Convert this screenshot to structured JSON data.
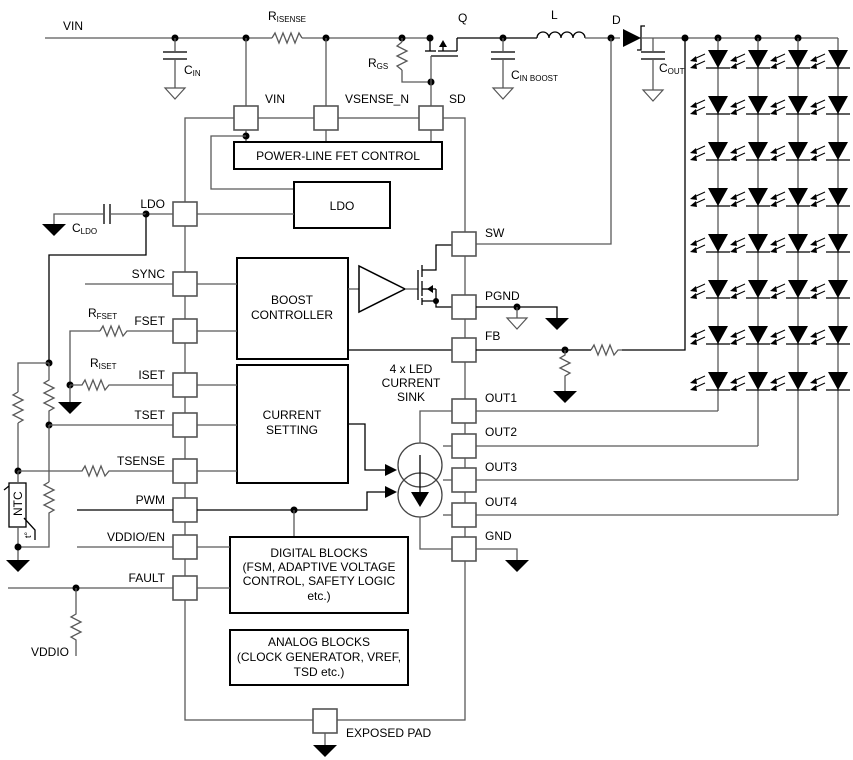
{
  "diagram": {
    "type": "circuit-block-diagram",
    "external_components": {
      "vin_label": "VIN",
      "r_isense": {
        "main": "R",
        "sub": "ISENSE"
      },
      "c_in": {
        "main": "C",
        "sub": "IN"
      },
      "q": "Q",
      "r_gs": {
        "main": "R",
        "sub": "GS"
      },
      "c_in_boost": {
        "main": "C",
        "sub": "IN BOOST"
      },
      "l": "L",
      "d": "D",
      "c_out": {
        "main": "C",
        "sub": "OUT"
      },
      "c_ldo": {
        "main": "C",
        "sub": "LDO"
      },
      "r_fset": {
        "main": "R",
        "sub": "FSET"
      },
      "r_iset": {
        "main": "R",
        "sub": "ISET"
      },
      "ntc": "NTC",
      "ntc_t": "t°",
      "vddio_label": "VDDIO"
    },
    "pins": {
      "vin": "VIN",
      "vsense_n": "VSENSE_N",
      "sd": "SD",
      "ldo": "LDO",
      "sync": "SYNC",
      "fset": "FSET",
      "iset": "ISET",
      "tset": "TSET",
      "tsense": "TSENSE",
      "pwm": "PWM",
      "vddio_en": "VDDIO/EN",
      "fault": "FAULT",
      "sw": "SW",
      "pgnd": "PGND",
      "fb": "FB",
      "out1": "OUT1",
      "out2": "OUT2",
      "out3": "OUT3",
      "out4": "OUT4",
      "gnd": "GND",
      "exposed_pad": "EXPOSED PAD"
    },
    "blocks": {
      "power_line_fet_control": "POWER-LINE FET CONTROL",
      "ldo": "LDO",
      "boost_controller": [
        "BOOST",
        "CONTROLLER"
      ],
      "current_setting": [
        "CURRENT",
        "SETTING"
      ],
      "led_current_sink": [
        "4 x LED",
        "CURRENT",
        "SINK"
      ],
      "digital_blocks": [
        "DIGITAL BLOCKS",
        "(FSM, ADAPTIVE VOLTAGE",
        "CONTROL, SAFETY LOGIC",
        "etc.)"
      ],
      "analog_blocks": [
        "ANALOG BLOCKS",
        "(CLOCK GENERATOR, VREF,",
        "TSD etc.)"
      ]
    },
    "led_matrix": {
      "strings": 4,
      "leds_per_string": 8
    }
  }
}
